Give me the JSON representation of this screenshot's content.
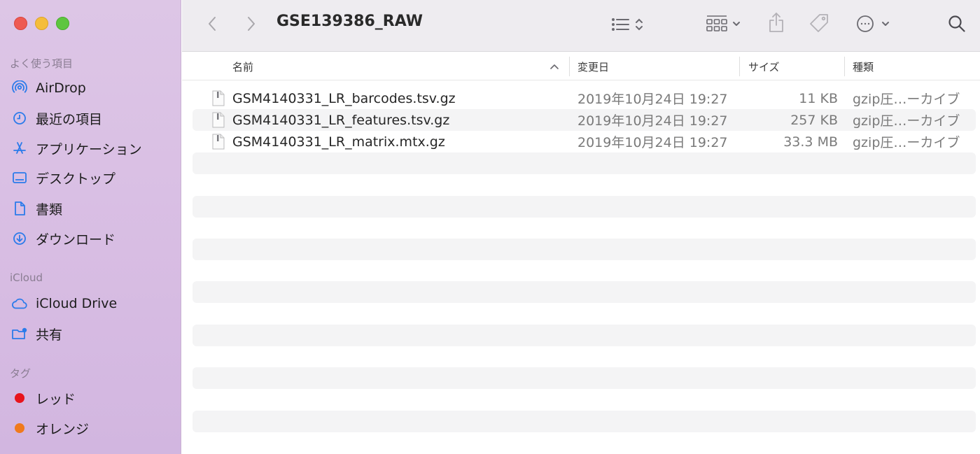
{
  "window": {
    "title": "GSE139386_RAW"
  },
  "sidebar": {
    "favorites_title": "よく使う項目",
    "favorites": [
      {
        "label": "AirDrop",
        "icon": "airdrop-icon"
      },
      {
        "label": "最近の項目",
        "icon": "clock-icon"
      },
      {
        "label": "アプリケーション",
        "icon": "applications-icon"
      },
      {
        "label": "デスクトップ",
        "icon": "desktop-icon"
      },
      {
        "label": "書類",
        "icon": "document-icon"
      },
      {
        "label": "ダウンロード",
        "icon": "download-icon"
      }
    ],
    "icloud_title": "iCloud",
    "icloud": [
      {
        "label": "iCloud Drive",
        "icon": "cloud-icon"
      },
      {
        "label": "共有",
        "icon": "shared-folder-icon"
      }
    ],
    "tags_title": "タグ",
    "tags": [
      {
        "label": "レッド",
        "color": "#e8141c"
      },
      {
        "label": "オレンジ",
        "color": "#f07a1c"
      }
    ]
  },
  "columns": {
    "name": "名前",
    "date": "変更日",
    "size": "サイズ",
    "kind": "種類"
  },
  "files": [
    {
      "name": "GSM4140331_LR_barcodes.tsv.gz",
      "date": "2019年10月24日 19:27",
      "size": "11 KB",
      "kind": "gzip圧…ーカイブ"
    },
    {
      "name": "GSM4140331_LR_features.tsv.gz",
      "date": "2019年10月24日 19:27",
      "size": "257 KB",
      "kind": "gzip圧…ーカイブ"
    },
    {
      "name": "GSM4140331_LR_matrix.mtx.gz",
      "date": "2019年10月24日 19:27",
      "size": "33.3 MB",
      "kind": "gzip圧…ーカイブ"
    }
  ]
}
